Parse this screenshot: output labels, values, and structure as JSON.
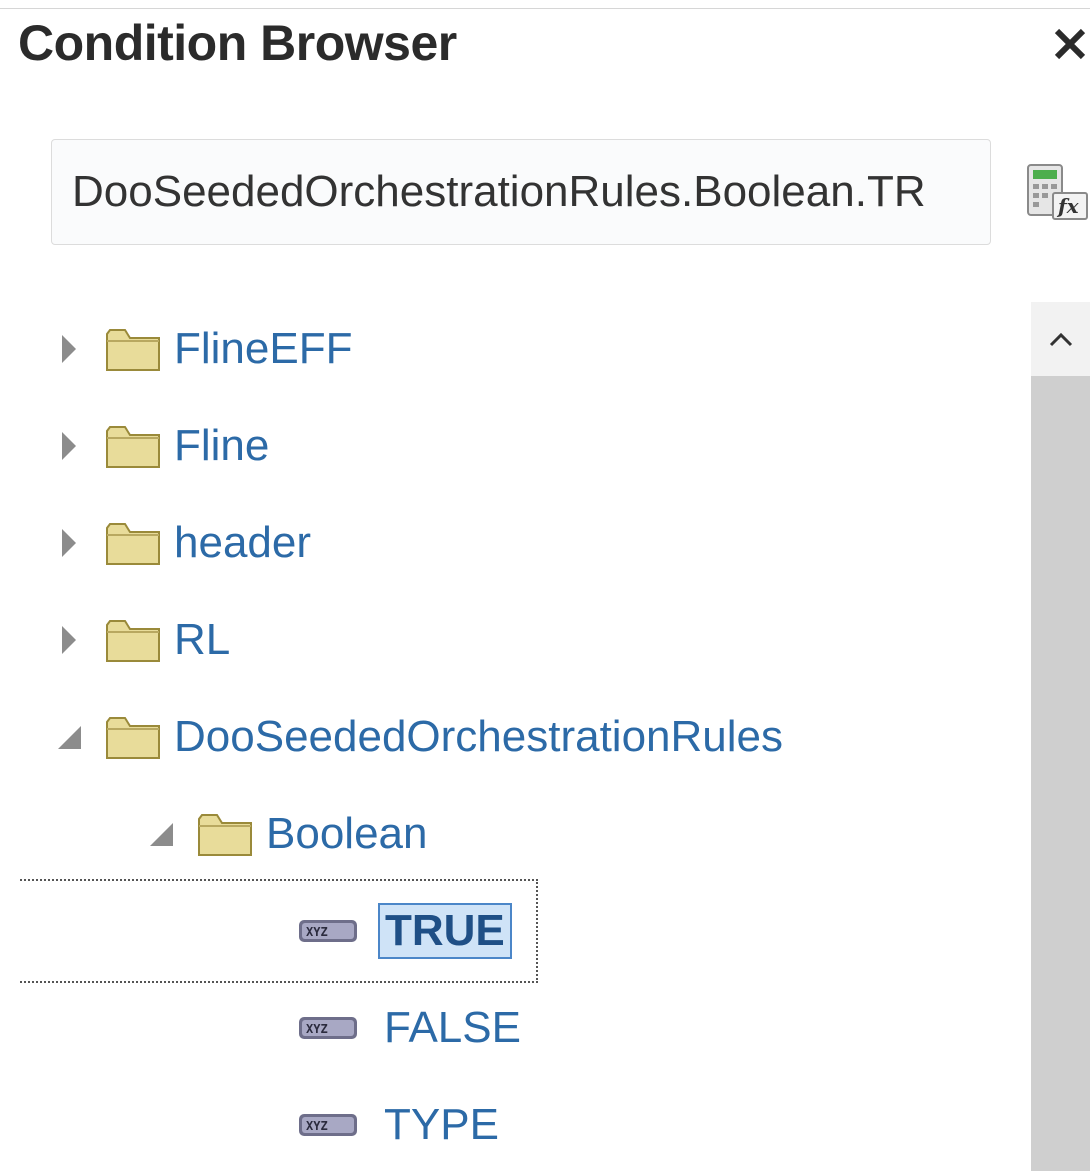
{
  "dialog": {
    "title": "Condition Browser",
    "close_icon": "close-icon"
  },
  "path_field": {
    "value": "DooSeededOrchestrationRules.Boolean.TR",
    "expression_icon": "expression-builder-icon"
  },
  "tree": {
    "items": [
      {
        "label": "FlineEFF",
        "type": "folder",
        "state": "collapsed"
      },
      {
        "label": "Fline",
        "type": "folder",
        "state": "collapsed"
      },
      {
        "label": "header",
        "type": "folder",
        "state": "collapsed"
      },
      {
        "label": "RL",
        "type": "folder",
        "state": "collapsed"
      },
      {
        "label": "DooSeededOrchestrationRules",
        "type": "folder",
        "state": "expanded"
      },
      {
        "label": "Boolean",
        "type": "folder",
        "state": "expanded"
      },
      {
        "label": "TRUE",
        "type": "value",
        "selected": true
      },
      {
        "label": "FALSE",
        "type": "value"
      },
      {
        "label": "TYPE",
        "type": "value"
      }
    ]
  },
  "colors": {
    "link": "#2c6aa7",
    "selection_fill": "#cfe3f7",
    "selection_border": "#4b86c8",
    "folder": "#e8dc9a",
    "scroll_track": "#cfcfcf"
  }
}
